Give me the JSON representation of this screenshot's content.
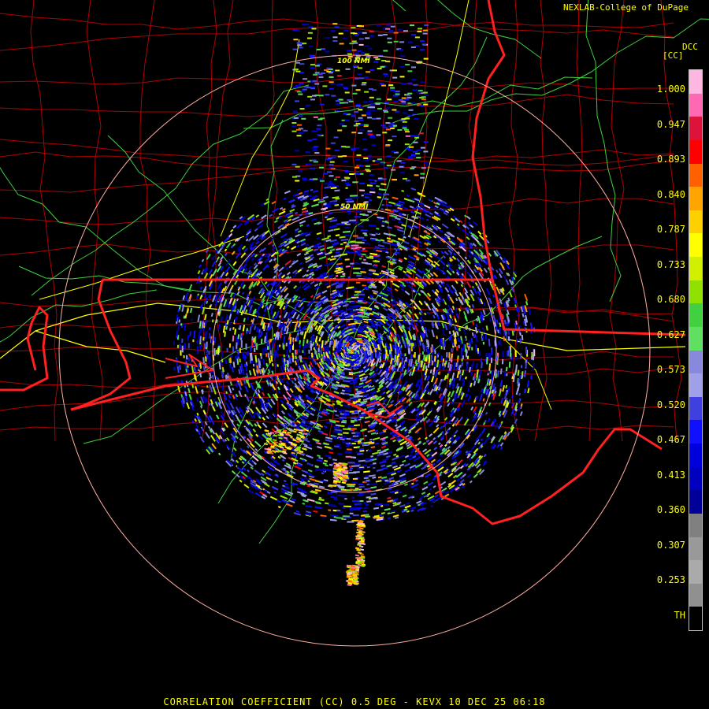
{
  "credit": "NEXLAB-College of DuPage",
  "product_code": "DCC",
  "units": "[CC]",
  "footer": "CORRELATION COEFFICIENT (CC) 0.5 DEG - KEVX 10 DEC 25 06:18",
  "range_rings": [
    {
      "label": "50 NMI"
    },
    {
      "label": "100 NMI"
    }
  ],
  "legend": {
    "ticks": [
      "1.000",
      "0.947",
      "0.893",
      "0.840",
      "0.787",
      "0.733",
      "0.680",
      "0.627",
      "0.573",
      "0.520",
      "0.467",
      "0.413",
      "0.360",
      "0.307",
      "0.253",
      "TH"
    ],
    "colors": [
      "#ffb6e0",
      "#ff69b4",
      "#dc143c",
      "#ff0000",
      "#ff6000",
      "#ffa500",
      "#ffd000",
      "#ffff00",
      "#d0f000",
      "#90e000",
      "#40d040",
      "#60e060",
      "#8888dd",
      "#a0a0e8",
      "#4040e0",
      "#1010ff",
      "#0000dd",
      "#0000c0",
      "#000099",
      "#808080",
      "#999999",
      "#aaaaaa",
      "#909090",
      "#000000"
    ]
  },
  "colors": {
    "state_border": "#ff2020",
    "county_border": "#b00000",
    "highway": "#ffff00",
    "road": "#40d040",
    "ring": "#ffb0a0"
  }
}
